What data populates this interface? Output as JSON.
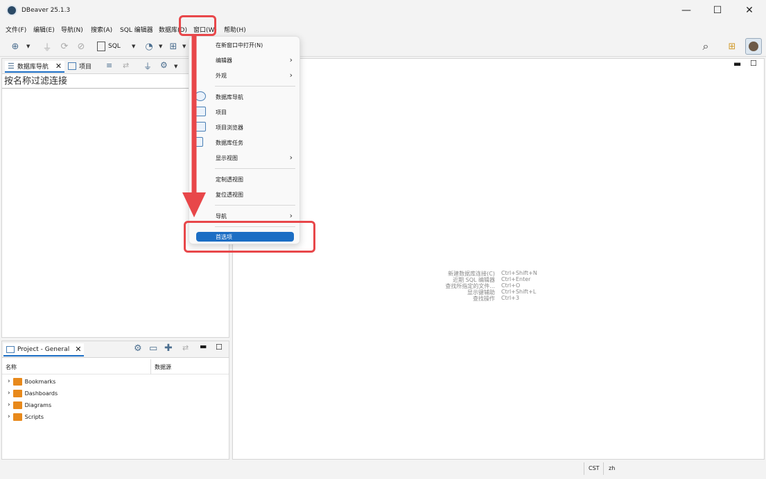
{
  "app": {
    "title": "DBeaver 25.1.3"
  },
  "window_controls": {
    "minimize": "—",
    "maximize": "☐",
    "close": "✕"
  },
  "menubar": [
    "文件(F)",
    "编辑(E)",
    "导航(N)",
    "搜索(A)",
    "SQL 编辑器",
    "数据库(D)",
    "窗口(W)",
    "帮助(H)"
  ],
  "toolbar": {
    "sql_label": "SQL"
  },
  "left_panel": {
    "tabs": [
      "数据库导航",
      "项目"
    ],
    "filter_placeholder": "按名称过滤连接"
  },
  "window_menu": {
    "items": [
      {
        "label": "在新窗口中打开(N)",
        "submenu": false,
        "icon": ""
      },
      {
        "label": "编辑器",
        "submenu": true,
        "icon": ""
      },
      {
        "label": "外观",
        "submenu": true,
        "icon": ""
      },
      {
        "label": "数据库导航",
        "submenu": false,
        "icon": "database-navigator-icon"
      },
      {
        "label": "项目",
        "submenu": false,
        "icon": "projects-icon"
      },
      {
        "label": "项目浏览器",
        "submenu": false,
        "icon": "project-explorer-icon"
      },
      {
        "label": "数据库任务",
        "submenu": false,
        "icon": "database-tasks-icon"
      },
      {
        "label": "显示视图",
        "submenu": true,
        "icon": ""
      },
      {
        "label": "定制透视图",
        "submenu": false,
        "icon": ""
      },
      {
        "label": "复位透视图",
        "submenu": false,
        "icon": ""
      },
      {
        "label": "导航",
        "submenu": true,
        "icon": ""
      },
      {
        "label": "首选项",
        "submenu": false,
        "icon": "",
        "selected": true
      }
    ]
  },
  "editor_hints": [
    {
      "action": "新建数据库连接(C)",
      "shortcut": "Ctrl+Shift+N"
    },
    {
      "action": "近期 SQL 编辑器",
      "shortcut": "Ctrl+Enter"
    },
    {
      "action": "查找所指定的文件...",
      "shortcut": "Ctrl+O"
    },
    {
      "action": "显示键辅助",
      "shortcut": "Ctrl+Shift+L"
    },
    {
      "action": "查找操作",
      "shortcut": "Ctrl+3"
    }
  ],
  "project_panel": {
    "tab": "Project - General",
    "columns": [
      "名称",
      "数据源"
    ],
    "items": [
      "Bookmarks",
      "Dashboards",
      "Diagrams",
      "Scripts"
    ]
  },
  "statusbar": {
    "timezone": "CST",
    "locale": "zh"
  },
  "colors": {
    "highlight": "#e8474a",
    "selected": "#1c6ec4",
    "folder": "#e8891b"
  }
}
